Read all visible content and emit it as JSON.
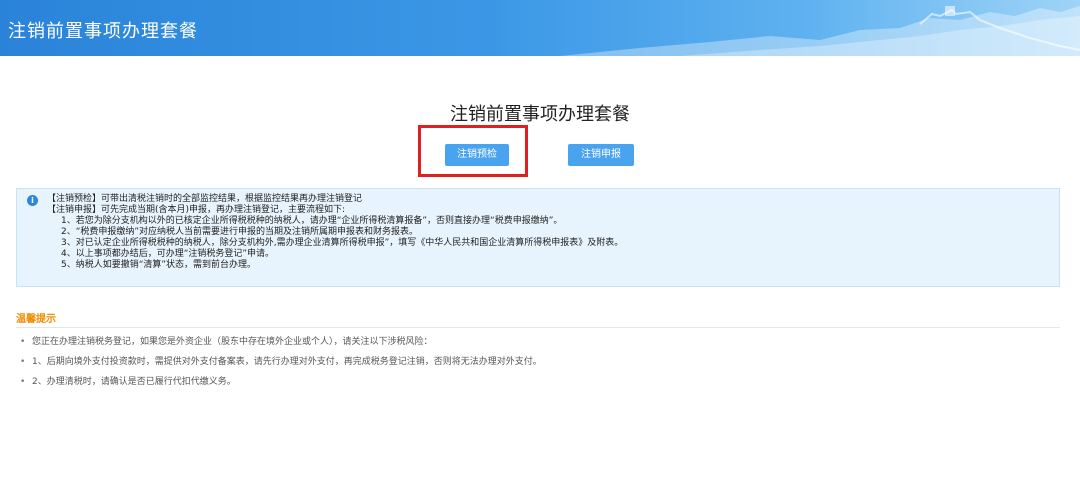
{
  "header": {
    "title": "注销前置事项办理套餐"
  },
  "main": {
    "page_title": "注销前置事项办理套餐",
    "buttons": {
      "pre_check": "注销预检",
      "declare": "注销申报"
    }
  },
  "info": {
    "icon": "info-icon",
    "lines": [
      "【注销预检】可带出清税注销时的全部监控结果，根据监控结果再办理注销登记",
      "【注销申报】可先完成当期(含本月)申报，再办理注销登记，主要流程如下:",
      "1、若您为除分支机构以外的已核定企业所得税税种的纳税人，请办理“企业所得税清算报备”，否则直接办理“税费申报缴纳”。",
      "2、“税费申报缴纳”对应纳税人当前需要进行申报的当期及注销所属期申报表和财务报表。",
      "3、对已认定企业所得税税种的纳税人，除分支机构外,需办理企业清算所得税申报”，填写《中华人民共和国企业清算所得税申报表》及附表。",
      "4、以上事项都办结后，可办理“注销税务登记”申请。",
      "5、纳税人如要撤销“清算”状态，需到前台办理。"
    ]
  },
  "tips": {
    "title": "温馨提示",
    "items": [
      "您正在办理注销税务登记，如果您是外资企业（股东中存在境外企业或个人），请关注以下涉税风险：",
      "1、后期向境外支付投资款时，需提供对外支付备案表，请先行办理对外支付，再完成税务登记注销，否则将无法办理对外支付。",
      "2、办理清税时，请确认是否已履行代扣代缴义务。"
    ]
  },
  "colors": {
    "header": "#3b97e6",
    "button": "#4aa3ef",
    "highlight": "#e02020",
    "tips_title": "#f08c00"
  }
}
